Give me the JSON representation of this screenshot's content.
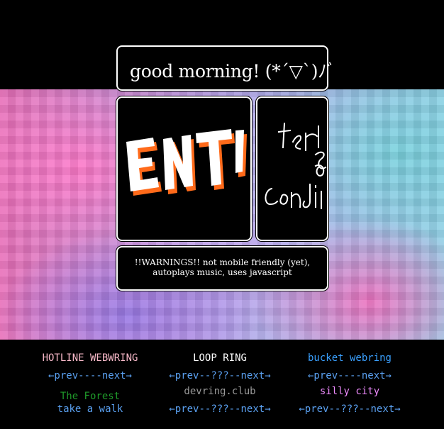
{
  "greeting": {
    "text": "good morning! (*´▽`)ﾉﾞ"
  },
  "banners": {
    "left": {
      "art_text": "ENT!",
      "colors": {
        "fill": "#ffffff",
        "shadow": "#ff6a1a"
      }
    },
    "right": {
      "art_lines": [
        "ter",
        "8",
        "condi"
      ],
      "color": "#ffffff"
    }
  },
  "warning": {
    "text": "!!WARNINGS!! not mobile friendly (yet), autoplays music, uses javascript"
  },
  "webrings": {
    "col1": {
      "title": "HOTLINE WEBWRING",
      "nav": "←prev----next→",
      "sub": "The Forest",
      "sub2": "take a walk"
    },
    "col2": {
      "title": "LOOP RING",
      "nav": "←prev--???--next→",
      "sub": "devring.club",
      "nav2": "←prev--???--next→"
    },
    "col3": {
      "title": "bucket webring",
      "nav": "←prev----next→",
      "sub": "silly city",
      "nav2": "←prev--???--next→"
    }
  },
  "colors": {
    "background": "#000000",
    "hotline_title": "#f7b8c8",
    "link_blue": "#5aa0f0",
    "forest_green": "#1f9a2a",
    "gray": "#9a9a9a",
    "bucket_blue": "#3aa0ff",
    "silly_pink": "#f08cff",
    "white": "#ffffff"
  }
}
